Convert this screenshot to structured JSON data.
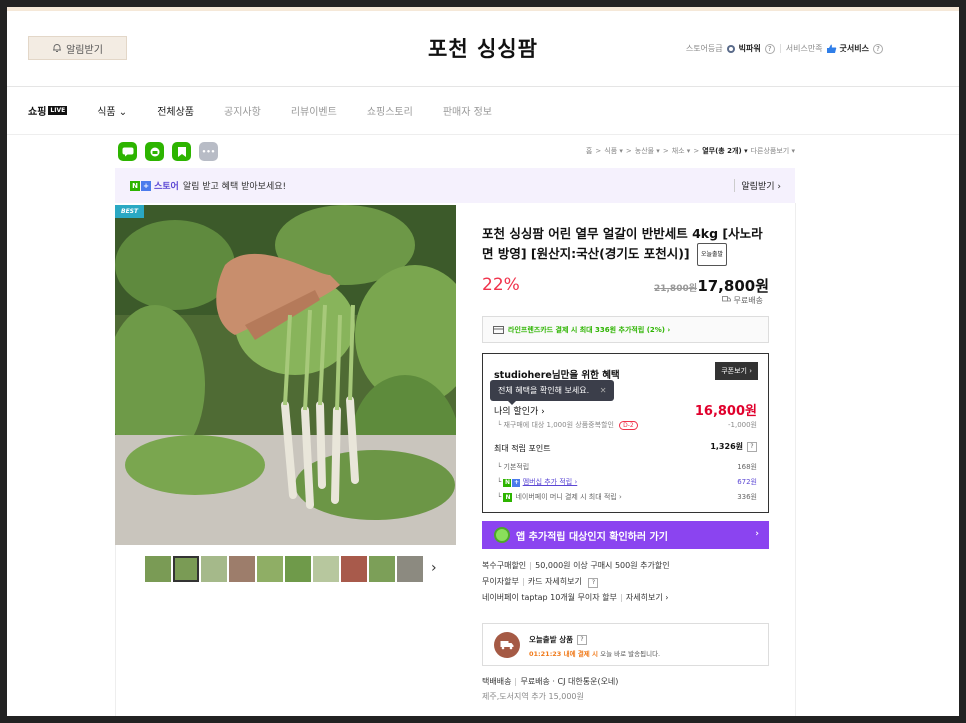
{
  "header": {
    "alarm_button": "알림받기",
    "store_title": "포천 싱싱팜",
    "grade_label": "스토어등급",
    "grade_value": "빅파워",
    "service_label": "서비스만족",
    "service_value": "굿서비스"
  },
  "nav": {
    "items": [
      {
        "label": "쇼핑",
        "badge": "LIVE"
      },
      {
        "label": "식품 ⌄"
      },
      {
        "label": "전체상품"
      },
      {
        "label": "공지사항"
      },
      {
        "label": "리뷰이벤트"
      },
      {
        "label": "쇼핑스토리"
      },
      {
        "label": "판매자 정보"
      }
    ]
  },
  "breadcrumb": {
    "items": [
      "홈",
      "식품 ▾",
      "농산물 ▾",
      "채소 ▾"
    ],
    "current": "열무(총 2개) ▾",
    "extra": "다른상품보기 ▾",
    "sep": ">"
  },
  "notice": {
    "store": "스토어",
    "text": "알림 받고 혜택 받아보세요!",
    "action": "알림받기 ›"
  },
  "product": {
    "best_badge": "BEST",
    "title": "포천 싱싱팜 어린 열무 얼갈이 반반세트 4kg [사노라면 방영] [원산지:국산(경기도 포천시)]",
    "tag": "오늘출발",
    "discount": "22%",
    "original_price": "21,800원",
    "sale_price": "17,800원",
    "shipping_free": "무료배송",
    "thumbnail_count": 10,
    "selected_thumbnail": 2
  },
  "card_promo": "라인프렌즈카드 결제 시 최대 336원 추가적립 (2%) ›",
  "benefit": {
    "heading": "studiohere님만을 위한 혜택",
    "coupon_button": "쿠폰보기 ›",
    "tooltip": "전체 혜택을 확인해 보세요.",
    "tooltip_close": "✕",
    "my_price_label": "나의 할인가 ›",
    "my_price": "16,800원",
    "repurchase": "재구매에 대상 1,000원 상품중복할인",
    "dday": "D-2",
    "repurchase_amount": "-1,000원",
    "points_label": "최대 적립 포인트",
    "points_value": "1,326원",
    "rows": [
      {
        "label": "기본적립",
        "value": "168원"
      },
      {
        "label": "멤버십 추가 적립 ›",
        "value": "672원"
      },
      {
        "label": "네이버페이 머니 결제 시 최대 적립 ›",
        "value": "336원"
      }
    ]
  },
  "app_banner": "앱 추가적립 대상인지 확인하러 가기",
  "extras": {
    "multi_label": "복수구매할인",
    "multi_text": "50,000원 이상 구매시 500원 추가할인",
    "interest_label": "무이자할부",
    "interest_text": "카드 자세히보기",
    "npay_text": "네이버페이 taptap 10개월 무이자 할부",
    "npay_link": "자세히보기 ›"
  },
  "today": {
    "title": "오늘출발 상품",
    "time": "01:21:23 내에 결제 시",
    "sub": "오늘 바로 발송됩니다."
  },
  "delivery": {
    "label": "택배배송",
    "text": "무료배송 · CJ 대한통운(오네)",
    "jeju": "제주,도서지역 추가 15,000원"
  },
  "colors": {
    "accent_red": "#f0324b",
    "naver_green": "#2db400",
    "purple": "#8b44f0"
  }
}
